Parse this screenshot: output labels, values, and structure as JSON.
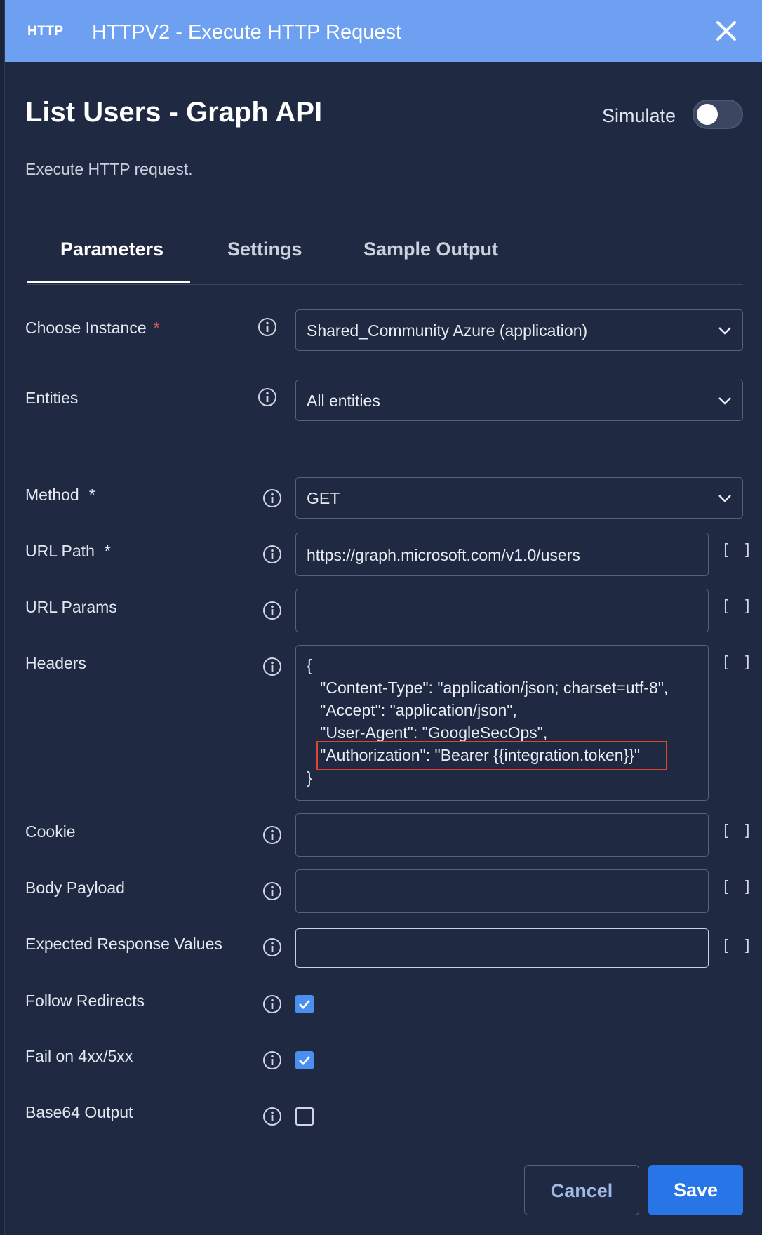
{
  "header": {
    "badge": "HTTP",
    "title": "HTTPV2 - Execute HTTP Request"
  },
  "action": {
    "name": "List Users - Graph API",
    "description": "Execute HTTP request.",
    "simulate_label": "Simulate",
    "simulate_on": false
  },
  "tabs": [
    {
      "label": "Parameters",
      "active": true
    },
    {
      "label": "Settings",
      "active": false
    },
    {
      "label": "Sample Output",
      "active": false
    }
  ],
  "fields": {
    "instance": {
      "label": "Choose Instance",
      "required": "*",
      "value": "Shared_Community Azure (application)"
    },
    "entities": {
      "label": "Entities",
      "value": "All entities"
    },
    "method": {
      "label": "Method",
      "required": "*",
      "value": "GET"
    },
    "url_path": {
      "label": "URL Path",
      "required": "*",
      "value": "https://graph.microsoft.com/v1.0/users"
    },
    "url_params": {
      "label": "URL Params",
      "value": ""
    },
    "headers": {
      "label": "Headers",
      "value": "{\n   \"Content-Type\": \"application/json; charset=utf-8\",\n   \"Accept\": \"application/json\",\n   \"User-Agent\": \"GoogleSecOps\",\n   \"Authorization\": \"Bearer {{integration.token}}\"\n}"
    },
    "cookie": {
      "label": "Cookie",
      "value": ""
    },
    "body_payload": {
      "label": "Body Payload",
      "value": ""
    },
    "expected_response": {
      "label": "Expected Response Values",
      "value": ""
    },
    "follow_redirects": {
      "label": "Follow Redirects",
      "checked": true
    },
    "fail_on_error": {
      "label": "Fail on 4xx/5xx",
      "checked": true
    },
    "base64_output": {
      "label": "Base64 Output",
      "checked": false
    }
  },
  "brackets_label": "[ ]",
  "buttons": {
    "cancel": "Cancel",
    "save": "Save"
  },
  "colors": {
    "header_bg": "#6ea0f2",
    "panel_bg": "#1f2a42",
    "accent": "#2775e6",
    "required": "#e05a5a",
    "highlight": "#e0452c"
  }
}
